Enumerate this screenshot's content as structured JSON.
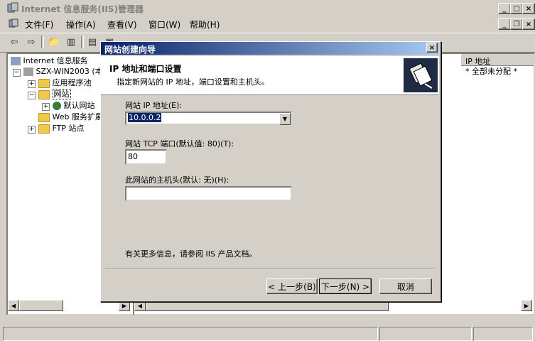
{
  "window": {
    "title": "Internet 信息服务(IIS)管理器"
  },
  "menu": [
    {
      "label": "文件(F)"
    },
    {
      "label": "操作(A)"
    },
    {
      "label": "查看(V)"
    },
    {
      "label": "窗口(W)"
    },
    {
      "label": "帮助(H)"
    }
  ],
  "tree": {
    "root": "Internet 信息服务",
    "server": "SZX-WIN2003 (本",
    "app_pools": "应用程序池",
    "websites": "网站",
    "default_site": "默认网站",
    "web_ext": "Web 服务扩展",
    "ftp": "FTP 站点"
  },
  "list": {
    "col_ip": "IP 地址",
    "row_ip": "* 全部未分配 *"
  },
  "dialog": {
    "title": "网站创建向导",
    "header_title": "IP 地址和端口设置",
    "header_subtitle": "指定新网站的 IP 地址，端口设置和主机头。",
    "ip_label": "网站 IP 地址(E):",
    "ip_value": "10.0.0.2",
    "port_label": "网站 TCP 端口(默认值: 80)(T):",
    "port_value": "80",
    "host_label": "此网站的主机头(默认: 无)(H):",
    "host_value": "",
    "info_text": "有关更多信息，请参阅 IIS 产品文档。",
    "back_button": "< 上一步(B)",
    "next_button": "下一步(N) >",
    "cancel_button": "取消"
  }
}
